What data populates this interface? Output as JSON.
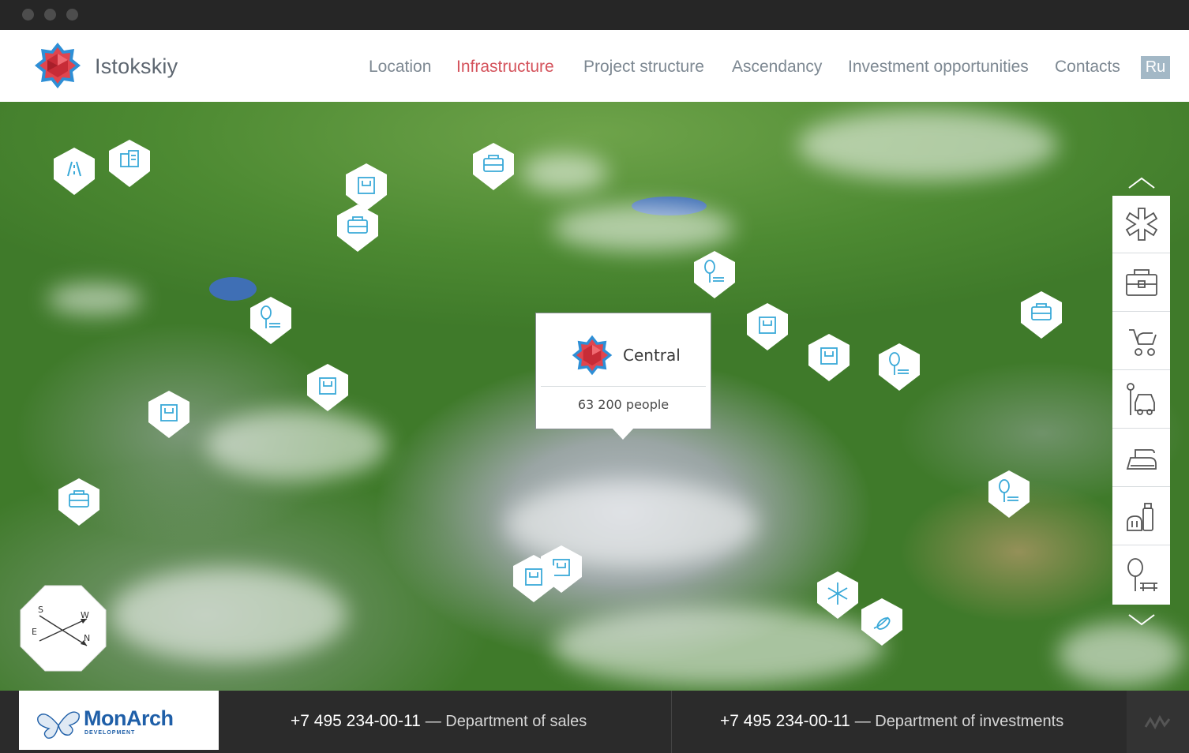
{
  "header": {
    "brand": "Istokskiy",
    "nav": [
      {
        "label": "Location",
        "active": false
      },
      {
        "label": "Infrastructure",
        "active": true
      },
      {
        "label": "Project structure",
        "active": false
      },
      {
        "label": "Ascendancy",
        "active": false
      },
      {
        "label": "Investment opportunities",
        "active": false
      },
      {
        "label": "Contacts",
        "active": false
      }
    ],
    "lang": "Ru"
  },
  "popup": {
    "title": "Central",
    "population": "63 200 people"
  },
  "compass": {
    "s": "S",
    "w": "W",
    "e": "E",
    "n": "N"
  },
  "filters": [
    "medical-icon",
    "school-icon",
    "kindergarten-icon",
    "parking-icon",
    "services-icon",
    "food-store-icon",
    "park-icon"
  ],
  "footer": {
    "company": "MonArch",
    "company_sub": "DEVELOPMENT",
    "sales_phone": "+7 495 234-00-11",
    "sales_desc": "— Department of sales",
    "invest_phone": "+7 495 234-00-11",
    "invest_desc": "— Department of investments"
  },
  "colors": {
    "accent": "#d4525b",
    "pin": "#3aa9d8",
    "nav": "#7d8892",
    "lang_bg": "#a3b8c6"
  }
}
